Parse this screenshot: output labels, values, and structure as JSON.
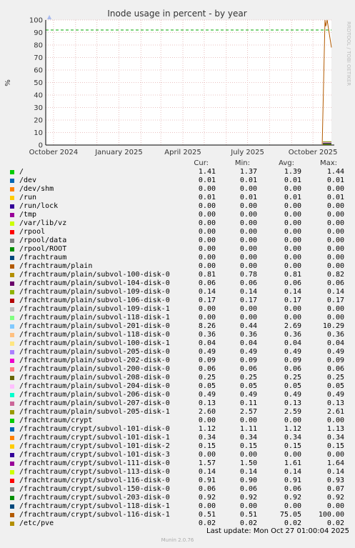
{
  "chart_data": {
    "type": "line",
    "title": "Inode usage in percent - by year",
    "ylabel": "%",
    "watermark": "RRDTOOL / TOBI OETIKER",
    "ylim": [
      0,
      100
    ],
    "yticks": [
      0,
      10,
      20,
      30,
      40,
      50,
      60,
      70,
      80,
      90,
      100
    ],
    "xticks": [
      "October 2024",
      "January 2025",
      "April 2025",
      "July 2025",
      "October 2025"
    ],
    "warning_level": 92,
    "grid": true,
    "series_note": "Most series stay near 0; /frachtraum/crypt/subvol-116-disk-1 spikes to 100 at the end of the period.",
    "highlight_series": {
      "name": "/frachtraum/crypt/subvol-116-disk-1",
      "x": [
        "2025-10-14",
        "2025-10-18",
        "2025-10-19",
        "2025-10-21",
        "2025-10-27"
      ],
      "y": [
        0.5,
        100,
        95,
        100,
        78
      ]
    }
  },
  "legend": {
    "headers": [
      "Cur:",
      "Min:",
      "Avg:",
      "Max:"
    ],
    "rows": [
      {
        "name": "/",
        "color": "#00cc00",
        "cur": "1.41",
        "min": "1.37",
        "avg": "1.39",
        "max": "1.44"
      },
      {
        "name": "/dev",
        "color": "#0066b3",
        "cur": "0.01",
        "min": "0.01",
        "avg": "0.01",
        "max": "0.01"
      },
      {
        "name": "/dev/shm",
        "color": "#ff8000",
        "cur": "0.00",
        "min": "0.00",
        "avg": "0.00",
        "max": "0.00"
      },
      {
        "name": "/run",
        "color": "#ffcc00",
        "cur": "0.01",
        "min": "0.01",
        "avg": "0.01",
        "max": "0.01"
      },
      {
        "name": "/run/lock",
        "color": "#330099",
        "cur": "0.00",
        "min": "0.00",
        "avg": "0.00",
        "max": "0.00"
      },
      {
        "name": "/tmp",
        "color": "#990099",
        "cur": "0.00",
        "min": "0.00",
        "avg": "0.00",
        "max": "0.00"
      },
      {
        "name": "/var/lib/vz",
        "color": "#ccff00",
        "cur": "0.00",
        "min": "0.00",
        "avg": "0.00",
        "max": "0.00"
      },
      {
        "name": "/rpool",
        "color": "#ff0000",
        "cur": "0.00",
        "min": "0.00",
        "avg": "0.00",
        "max": "0.00"
      },
      {
        "name": "/rpool/data",
        "color": "#808080",
        "cur": "0.00",
        "min": "0.00",
        "avg": "0.00",
        "max": "0.00"
      },
      {
        "name": "/rpool/ROOT",
        "color": "#008f00",
        "cur": "0.00",
        "min": "0.00",
        "avg": "0.00",
        "max": "0.00"
      },
      {
        "name": "/frachtraum",
        "color": "#00487d",
        "cur": "0.00",
        "min": "0.00",
        "avg": "0.00",
        "max": "0.00"
      },
      {
        "name": "/frachtraum/plain",
        "color": "#b35a00",
        "cur": "0.00",
        "min": "0.00",
        "avg": "0.00",
        "max": "0.00"
      },
      {
        "name": "/frachtraum/plain/subvol-100-disk-0",
        "color": "#b38f00",
        "cur": "0.81",
        "min": "0.78",
        "avg": "0.81",
        "max": "0.82"
      },
      {
        "name": "/frachtraum/plain/subvol-104-disk-0",
        "color": "#6b006b",
        "cur": "0.06",
        "min": "0.06",
        "avg": "0.06",
        "max": "0.06"
      },
      {
        "name": "/frachtraum/plain/subvol-109-disk-0",
        "color": "#8fb300",
        "cur": "0.14",
        "min": "0.14",
        "avg": "0.14",
        "max": "0.14"
      },
      {
        "name": "/frachtraum/plain/subvol-106-disk-0",
        "color": "#b30000",
        "cur": "0.17",
        "min": "0.17",
        "avg": "0.17",
        "max": "0.17"
      },
      {
        "name": "/frachtraum/plain/subvol-109-disk-1",
        "color": "#bebebe",
        "cur": "0.00",
        "min": "0.00",
        "avg": "0.00",
        "max": "0.00"
      },
      {
        "name": "/frachtraum/plain/subvol-118-disk-1",
        "color": "#80ff80",
        "cur": "0.00",
        "min": "0.00",
        "avg": "0.00",
        "max": "0.00"
      },
      {
        "name": "/frachtraum/plain/subvol-201-disk-0",
        "color": "#80c9ff",
        "cur": "8.26",
        "min": "0.44",
        "avg": "2.69",
        "max": "10.29"
      },
      {
        "name": "/frachtraum/plain/subvol-118-disk-0",
        "color": "#ffc080",
        "cur": "0.36",
        "min": "0.36",
        "avg": "0.36",
        "max": "0.36"
      },
      {
        "name": "/frachtraum/plain/subvol-100-disk-1",
        "color": "#ffe680",
        "cur": "0.04",
        "min": "0.04",
        "avg": "0.04",
        "max": "0.04"
      },
      {
        "name": "/frachtraum/plain/subvol-205-disk-0",
        "color": "#aa80ff",
        "cur": "0.49",
        "min": "0.49",
        "avg": "0.49",
        "max": "0.49"
      },
      {
        "name": "/frachtraum/plain/subvol-202-disk-0",
        "color": "#ee00cc",
        "cur": "0.09",
        "min": "0.09",
        "avg": "0.09",
        "max": "0.09"
      },
      {
        "name": "/frachtraum/plain/subvol-200-disk-0",
        "color": "#ff8080",
        "cur": "0.06",
        "min": "0.06",
        "avg": "0.06",
        "max": "0.06"
      },
      {
        "name": "/frachtraum/plain/subvol-208-disk-0",
        "color": "#666600",
        "cur": "0.25",
        "min": "0.25",
        "avg": "0.25",
        "max": "0.25"
      },
      {
        "name": "/frachtraum/plain/subvol-204-disk-0",
        "color": "#ffbfff",
        "cur": "0.05",
        "min": "0.05",
        "avg": "0.05",
        "max": "0.05"
      },
      {
        "name": "/frachtraum/plain/subvol-206-disk-0",
        "color": "#00ffcc",
        "cur": "0.49",
        "min": "0.49",
        "avg": "0.49",
        "max": "0.49"
      },
      {
        "name": "/frachtraum/plain/subvol-207-disk-0",
        "color": "#cc6699",
        "cur": "0.13",
        "min": "0.11",
        "avg": "0.13",
        "max": "0.13"
      },
      {
        "name": "/frachtraum/plain/subvol-205-disk-1",
        "color": "#999900",
        "cur": "2.60",
        "min": "2.57",
        "avg": "2.59",
        "max": "2.61"
      },
      {
        "name": "/frachtraum/crypt",
        "color": "#00cc00",
        "cur": "0.00",
        "min": "0.00",
        "avg": "0.00",
        "max": "0.00"
      },
      {
        "name": "/frachtraum/crypt/subvol-101-disk-0",
        "color": "#0066b3",
        "cur": "1.12",
        "min": "1.11",
        "avg": "1.12",
        "max": "1.13"
      },
      {
        "name": "/frachtraum/crypt/subvol-101-disk-1",
        "color": "#ff8000",
        "cur": "0.34",
        "min": "0.34",
        "avg": "0.34",
        "max": "0.34"
      },
      {
        "name": "/frachtraum/crypt/subvol-101-disk-2",
        "color": "#ffcc00",
        "cur": "0.15",
        "min": "0.15",
        "avg": "0.15",
        "max": "0.15"
      },
      {
        "name": "/frachtraum/crypt/subvol-101-disk-3",
        "color": "#330099",
        "cur": "0.00",
        "min": "0.00",
        "avg": "0.00",
        "max": "0.00"
      },
      {
        "name": "/frachtraum/crypt/subvol-111-disk-0",
        "color": "#990099",
        "cur": "1.57",
        "min": "1.50",
        "avg": "1.61",
        "max": "1.64"
      },
      {
        "name": "/frachtraum/crypt/subvol-113-disk-0",
        "color": "#ccff00",
        "cur": "0.14",
        "min": "0.14",
        "avg": "0.14",
        "max": "0.14"
      },
      {
        "name": "/frachtraum/crypt/subvol-116-disk-0",
        "color": "#ff0000",
        "cur": "0.91",
        "min": "0.90",
        "avg": "0.91",
        "max": "0.93"
      },
      {
        "name": "/frachtraum/crypt/subvol-150-disk-0",
        "color": "#808080",
        "cur": "0.06",
        "min": "0.06",
        "avg": "0.06",
        "max": "0.07"
      },
      {
        "name": "/frachtraum/crypt/subvol-203-disk-0",
        "color": "#008f00",
        "cur": "0.92",
        "min": "0.92",
        "avg": "0.92",
        "max": "0.92"
      },
      {
        "name": "/frachtraum/crypt/subvol-118-disk-1",
        "color": "#00487d",
        "cur": "0.00",
        "min": "0.00",
        "avg": "0.00",
        "max": "0.00"
      },
      {
        "name": "/frachtraum/crypt/subvol-116-disk-1",
        "color": "#b35a00",
        "cur": "0.51",
        "min": "0.51",
        "avg": "75.05",
        "max": "100.00"
      },
      {
        "name": "/etc/pve",
        "color": "#b38f00",
        "cur": "0.02",
        "min": "0.02",
        "avg": "0.02",
        "max": "0.02"
      }
    ]
  },
  "footer": {
    "last_update": "Last update: Mon Oct 27 01:00:04 2025",
    "munin_version": "Munin 2.0.76"
  }
}
